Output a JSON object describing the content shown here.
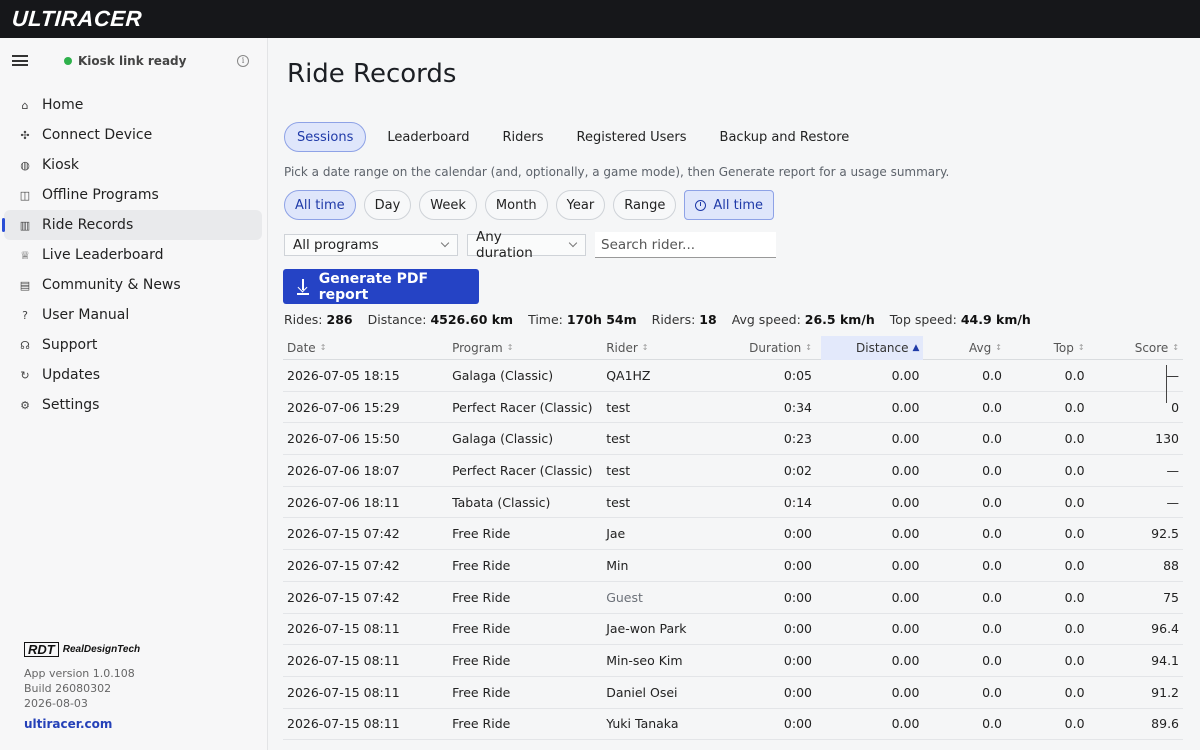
{
  "app": {
    "logo": "ULTIRACER"
  },
  "sidebar": {
    "status": "Kiosk link ready",
    "info": "i",
    "items": [
      {
        "label": "Home",
        "icon": "⌂",
        "name": "home"
      },
      {
        "label": "Connect Device",
        "icon": "✣",
        "name": "connect-device"
      },
      {
        "label": "Kiosk",
        "icon": "◍",
        "name": "kiosk"
      },
      {
        "label": "Offline Programs",
        "icon": "◫",
        "name": "offline-programs"
      },
      {
        "label": "Ride Records",
        "icon": "▥",
        "name": "ride-records"
      },
      {
        "label": "Live Leaderboard",
        "icon": "♕",
        "name": "live-leaderboard"
      },
      {
        "label": "Community & News",
        "icon": "▤",
        "name": "community-news"
      },
      {
        "label": "User Manual",
        "icon": "?",
        "name": "user-manual"
      },
      {
        "label": "Support",
        "icon": "☊",
        "name": "support"
      },
      {
        "label": "Updates",
        "icon": "↻",
        "name": "updates"
      },
      {
        "label": "Settings",
        "icon": "⚙",
        "name": "settings"
      }
    ],
    "active_index": 4,
    "brand_mark": "RDT",
    "brand_name": "RealDesignTech",
    "app_version": "App version 1.0.108",
    "build": "Build 26080302",
    "date": "2026-08-03",
    "site": "ultiracer.com"
  },
  "main": {
    "title": "Ride Records",
    "tabs": [
      "Sessions",
      "Leaderboard",
      "Riders",
      "Registered Users",
      "Backup and Restore"
    ],
    "active_tab": 0,
    "hint": "Pick a date range on the calendar (and, optionally, a game mode), then Generate report for a usage summary.",
    "ranges": [
      "All time",
      "Day",
      "Week",
      "Month",
      "Year",
      "Range"
    ],
    "active_range": 0,
    "range_chip": "All time",
    "program_filter": "All programs",
    "duration_filter": "Any duration",
    "search_placeholder": "Search rider...",
    "generate_label": "Generate PDF report",
    "stats": [
      {
        "label": "Rides:",
        "value": "286"
      },
      {
        "label": "Distance:",
        "value": "4526.60 km"
      },
      {
        "label": "Time:",
        "value": "170h 54m"
      },
      {
        "label": "Riders:",
        "value": "18"
      },
      {
        "label": "Avg speed:",
        "value": "26.5 km/h"
      },
      {
        "label": "Top speed:",
        "value": "44.9 km/h"
      }
    ],
    "columns": {
      "date": "Date",
      "program": "Program",
      "rider": "Rider",
      "duration": "Duration",
      "distance": "Distance",
      "avg": "Avg",
      "top": "Top",
      "score": "Score"
    },
    "sort_marker": "↕",
    "sort_active_marker": "▲",
    "rows": [
      {
        "date": "2026-07-05 18:15",
        "program": "Galaga (Classic)",
        "rider": "QA1HZ",
        "duration": "0:05",
        "distance": "0.00",
        "avg": "0.0",
        "top": "0.0",
        "score": "—"
      },
      {
        "date": "2026-07-06 15:29",
        "program": "Perfect Racer (Classic)",
        "rider": "test",
        "duration": "0:34",
        "distance": "0.00",
        "avg": "0.0",
        "top": "0.0",
        "score": "0"
      },
      {
        "date": "2026-07-06 15:50",
        "program": "Galaga (Classic)",
        "rider": "test",
        "duration": "0:23",
        "distance": "0.00",
        "avg": "0.0",
        "top": "0.0",
        "score": "130"
      },
      {
        "date": "2026-07-06 18:07",
        "program": "Perfect Racer (Classic)",
        "rider": "test",
        "duration": "0:02",
        "distance": "0.00",
        "avg": "0.0",
        "top": "0.0",
        "score": "—"
      },
      {
        "date": "2026-07-06 18:11",
        "program": "Tabata (Classic)",
        "rider": "test",
        "duration": "0:14",
        "distance": "0.00",
        "avg": "0.0",
        "top": "0.0",
        "score": "—"
      },
      {
        "date": "2026-07-15 07:42",
        "program": "Free Ride",
        "rider": "Jae",
        "duration": "0:00",
        "distance": "0.00",
        "avg": "0.0",
        "top": "0.0",
        "score": "92.5"
      },
      {
        "date": "2026-07-15 07:42",
        "program": "Free Ride",
        "rider": "Min",
        "duration": "0:00",
        "distance": "0.00",
        "avg": "0.0",
        "top": "0.0",
        "score": "88"
      },
      {
        "date": "2026-07-15 07:42",
        "program": "Free Ride",
        "rider": "Guest",
        "duration": "0:00",
        "distance": "0.00",
        "avg": "0.0",
        "top": "0.0",
        "score": "75",
        "muted": true
      },
      {
        "date": "2026-07-15 08:11",
        "program": "Free Ride",
        "rider": "Jae-won Park",
        "duration": "0:00",
        "distance": "0.00",
        "avg": "0.0",
        "top": "0.0",
        "score": "96.4"
      },
      {
        "date": "2026-07-15 08:11",
        "program": "Free Ride",
        "rider": "Min-seo Kim",
        "duration": "0:00",
        "distance": "0.00",
        "avg": "0.0",
        "top": "0.0",
        "score": "94.1"
      },
      {
        "date": "2026-07-15 08:11",
        "program": "Free Ride",
        "rider": "Daniel Osei",
        "duration": "0:00",
        "distance": "0.00",
        "avg": "0.0",
        "top": "0.0",
        "score": "91.2"
      },
      {
        "date": "2026-07-15 08:11",
        "program": "Free Ride",
        "rider": "Yuki Tanaka",
        "duration": "0:00",
        "distance": "0.00",
        "avg": "0.0",
        "top": "0.0",
        "score": "89.6"
      }
    ]
  }
}
